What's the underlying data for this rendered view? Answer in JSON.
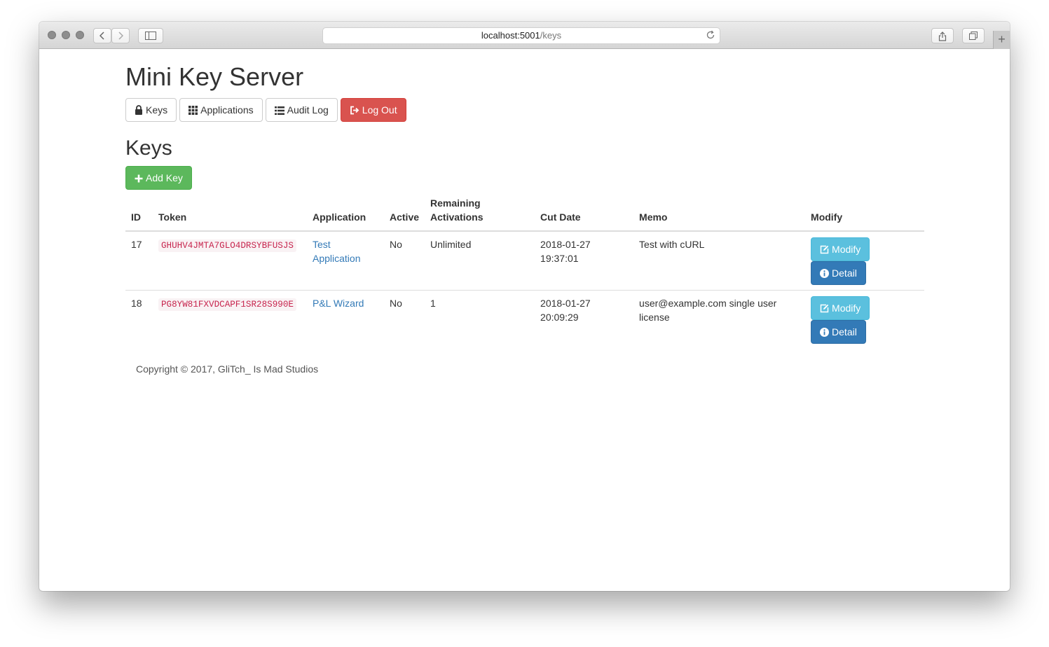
{
  "browser": {
    "url_host": "localhost:5001",
    "url_path": "/keys"
  },
  "page": {
    "title": "Mini Key Server",
    "nav": {
      "keys": "Keys",
      "applications": "Applications",
      "audit_log": "Audit Log",
      "log_out": "Log Out"
    },
    "section_title": "Keys",
    "add_key": "Add Key"
  },
  "table": {
    "headers": {
      "id": "ID",
      "token": "Token",
      "application": "Application",
      "active": "Active",
      "remaining_line1": "Remaining",
      "remaining_line2": "Activations",
      "cut_date": "Cut Date",
      "memo": "Memo",
      "modify": "Modify"
    },
    "rows": [
      {
        "id": "17",
        "token": "GHUHV4JMTA7GLO4DRSYBFUSJS",
        "app_line1": "Test",
        "app_line2": "Application",
        "active": "No",
        "remaining": "Unlimited",
        "date": "2018-01-27",
        "time": "19:37:01",
        "memo_line1": "Test with cURL",
        "memo_line2": "",
        "modify_label": "Modify",
        "detail_label": "Detail"
      },
      {
        "id": "18",
        "token": "PG8YW81FXVDCAPF1SR28S990E",
        "app_line1": "P&L Wizard",
        "app_line2": "",
        "active": "No",
        "remaining": "1",
        "date": "2018-01-27",
        "time": "20:09:29",
        "memo_line1": "user@example.com single user",
        "memo_line2": "license",
        "modify_label": "Modify",
        "detail_label": "Detail"
      }
    ]
  },
  "footer": "Copyright © 2017, GliTch_ Is Mad Studios",
  "colors": {
    "danger": "#d9534f",
    "success": "#5cb85c",
    "info": "#5bc0de",
    "primary": "#337ab7",
    "code": "#c7254e"
  }
}
